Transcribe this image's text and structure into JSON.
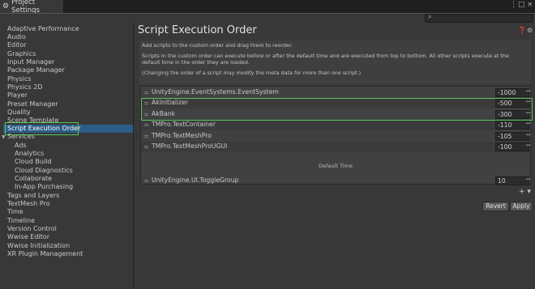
{
  "window": {
    "tab_title": "Project Settings",
    "tab_icon": "gear-icon",
    "more_label": "⋮",
    "maximize_label": "□",
    "close_label": "×"
  },
  "search": {
    "placeholder": "",
    "value": ""
  },
  "sidebar": {
    "selected": "Script Execution Order",
    "items": [
      {
        "label": "Adaptive Performance"
      },
      {
        "label": "Audio"
      },
      {
        "label": "Editor"
      },
      {
        "label": "Graphics"
      },
      {
        "label": "Input Manager"
      },
      {
        "label": "Package Manager"
      },
      {
        "label": "Physics"
      },
      {
        "label": "Physics 2D"
      },
      {
        "label": "Player"
      },
      {
        "label": "Preset Manager"
      },
      {
        "label": "Quality"
      },
      {
        "label": "Scene Template"
      },
      {
        "label": "Script Execution Order"
      },
      {
        "label": "Services"
      },
      {
        "label": "Ads"
      },
      {
        "label": "Analytics"
      },
      {
        "label": "Cloud Build"
      },
      {
        "label": "Cloud Diagnostics"
      },
      {
        "label": "Collaborate"
      },
      {
        "label": "In-App Purchasing"
      },
      {
        "label": "Tags and Layers"
      },
      {
        "label": "TextMesh Pro"
      },
      {
        "label": "Time"
      },
      {
        "label": "Timeline"
      },
      {
        "label": "Version Control"
      },
      {
        "label": "Wwise Editor"
      },
      {
        "label": "Wwise Initialization"
      },
      {
        "label": "XR Plugin Management"
      }
    ]
  },
  "main": {
    "title": "Script Execution Order",
    "help_icon": "help-icon",
    "settings_icon": "settings-icon",
    "help_lines": [
      "Add scripts to the custom order and drag them to reorder.",
      "Scripts in the custom order can execute before or after the default time and are executed from top to bottom. All other scripts execute at the default time in the order they are loaded.",
      "(Changing the order of a script may modify the meta data for more than one script.)"
    ],
    "rows_before": [
      {
        "name": "UnityEngine.EventSystems.EventSystem",
        "value": "-1000"
      },
      {
        "name": "AkInitializer",
        "value": "-500"
      },
      {
        "name": "AkBank",
        "value": "-300"
      },
      {
        "name": "TMPro.TextContainer",
        "value": "-110"
      },
      {
        "name": "TMPro.TextMeshPro",
        "value": "-105"
      },
      {
        "name": "TMPro.TextMeshProUGUI",
        "value": "-100"
      }
    ],
    "default_time_label": "Default Time",
    "rows_after": [
      {
        "name": "UnityEngine.UI.ToggleGroup",
        "value": "10"
      }
    ],
    "remove_label": "−",
    "add_label": "+ ▾",
    "revert_label": "Revert",
    "apply_label": "Apply"
  }
}
